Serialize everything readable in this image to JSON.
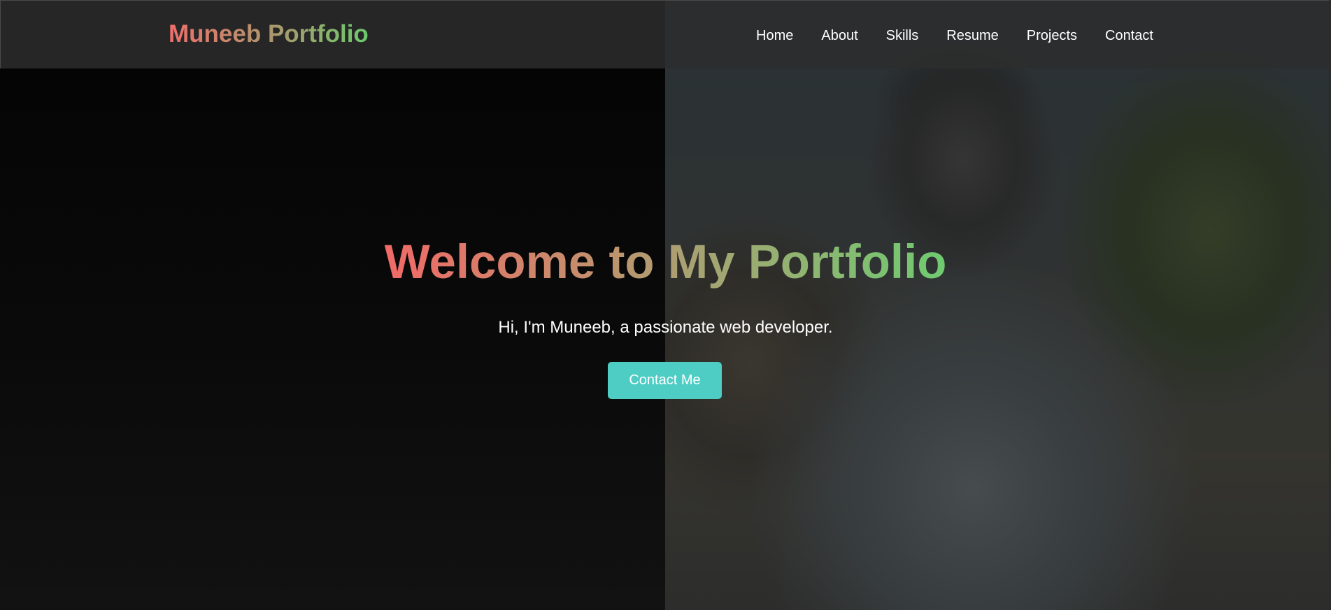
{
  "brand": {
    "name": "Muneeb Portfolio"
  },
  "nav": {
    "links": [
      {
        "label": "Home"
      },
      {
        "label": "About"
      },
      {
        "label": "Skills"
      },
      {
        "label": "Resume"
      },
      {
        "label": "Projects"
      },
      {
        "label": "Contact"
      }
    ]
  },
  "hero": {
    "title": "Welcome to My Portfolio",
    "subtitle": "Hi, I'm Muneeb, a passionate web developer.",
    "cta_label": "Contact Me"
  },
  "colors": {
    "accent": "#4ecdc4",
    "gradient_start": "#f06a68",
    "gradient_end": "#6fcb70",
    "nav_background": "#2d2d2d",
    "page_background": "#0b0b0b"
  }
}
